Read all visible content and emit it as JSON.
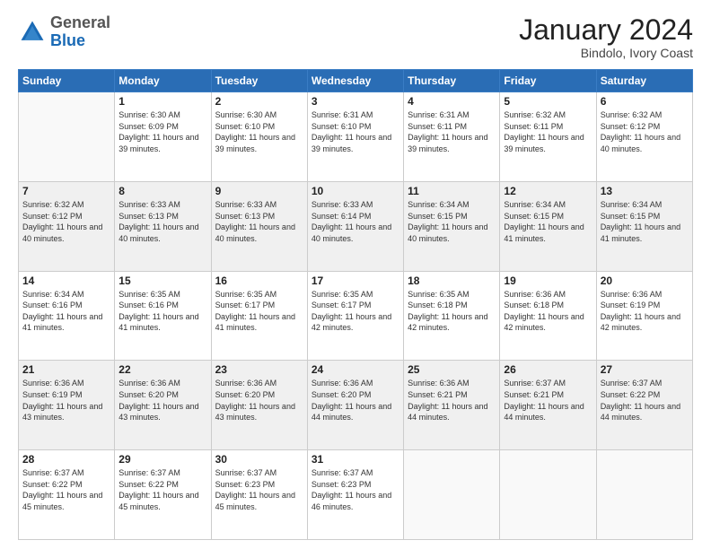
{
  "logo": {
    "general": "General",
    "blue": "Blue"
  },
  "header": {
    "month": "January 2024",
    "location": "Bindolo, Ivory Coast"
  },
  "weekdays": [
    "Sunday",
    "Monday",
    "Tuesday",
    "Wednesday",
    "Thursday",
    "Friday",
    "Saturday"
  ],
  "weeks": [
    [
      {
        "day": "",
        "sunrise": "",
        "sunset": "",
        "daylight": ""
      },
      {
        "day": "1",
        "sunrise": "Sunrise: 6:30 AM",
        "sunset": "Sunset: 6:09 PM",
        "daylight": "Daylight: 11 hours and 39 minutes."
      },
      {
        "day": "2",
        "sunrise": "Sunrise: 6:30 AM",
        "sunset": "Sunset: 6:10 PM",
        "daylight": "Daylight: 11 hours and 39 minutes."
      },
      {
        "day": "3",
        "sunrise": "Sunrise: 6:31 AM",
        "sunset": "Sunset: 6:10 PM",
        "daylight": "Daylight: 11 hours and 39 minutes."
      },
      {
        "day": "4",
        "sunrise": "Sunrise: 6:31 AM",
        "sunset": "Sunset: 6:11 PM",
        "daylight": "Daylight: 11 hours and 39 minutes."
      },
      {
        "day": "5",
        "sunrise": "Sunrise: 6:32 AM",
        "sunset": "Sunset: 6:11 PM",
        "daylight": "Daylight: 11 hours and 39 minutes."
      },
      {
        "day": "6",
        "sunrise": "Sunrise: 6:32 AM",
        "sunset": "Sunset: 6:12 PM",
        "daylight": "Daylight: 11 hours and 40 minutes."
      }
    ],
    [
      {
        "day": "7",
        "sunrise": "Sunrise: 6:32 AM",
        "sunset": "Sunset: 6:12 PM",
        "daylight": "Daylight: 11 hours and 40 minutes."
      },
      {
        "day": "8",
        "sunrise": "Sunrise: 6:33 AM",
        "sunset": "Sunset: 6:13 PM",
        "daylight": "Daylight: 11 hours and 40 minutes."
      },
      {
        "day": "9",
        "sunrise": "Sunrise: 6:33 AM",
        "sunset": "Sunset: 6:13 PM",
        "daylight": "Daylight: 11 hours and 40 minutes."
      },
      {
        "day": "10",
        "sunrise": "Sunrise: 6:33 AM",
        "sunset": "Sunset: 6:14 PM",
        "daylight": "Daylight: 11 hours and 40 minutes."
      },
      {
        "day": "11",
        "sunrise": "Sunrise: 6:34 AM",
        "sunset": "Sunset: 6:15 PM",
        "daylight": "Daylight: 11 hours and 40 minutes."
      },
      {
        "day": "12",
        "sunrise": "Sunrise: 6:34 AM",
        "sunset": "Sunset: 6:15 PM",
        "daylight": "Daylight: 11 hours and 41 minutes."
      },
      {
        "day": "13",
        "sunrise": "Sunrise: 6:34 AM",
        "sunset": "Sunset: 6:15 PM",
        "daylight": "Daylight: 11 hours and 41 minutes."
      }
    ],
    [
      {
        "day": "14",
        "sunrise": "Sunrise: 6:34 AM",
        "sunset": "Sunset: 6:16 PM",
        "daylight": "Daylight: 11 hours and 41 minutes."
      },
      {
        "day": "15",
        "sunrise": "Sunrise: 6:35 AM",
        "sunset": "Sunset: 6:16 PM",
        "daylight": "Daylight: 11 hours and 41 minutes."
      },
      {
        "day": "16",
        "sunrise": "Sunrise: 6:35 AM",
        "sunset": "Sunset: 6:17 PM",
        "daylight": "Daylight: 11 hours and 41 minutes."
      },
      {
        "day": "17",
        "sunrise": "Sunrise: 6:35 AM",
        "sunset": "Sunset: 6:17 PM",
        "daylight": "Daylight: 11 hours and 42 minutes."
      },
      {
        "day": "18",
        "sunrise": "Sunrise: 6:35 AM",
        "sunset": "Sunset: 6:18 PM",
        "daylight": "Daylight: 11 hours and 42 minutes."
      },
      {
        "day": "19",
        "sunrise": "Sunrise: 6:36 AM",
        "sunset": "Sunset: 6:18 PM",
        "daylight": "Daylight: 11 hours and 42 minutes."
      },
      {
        "day": "20",
        "sunrise": "Sunrise: 6:36 AM",
        "sunset": "Sunset: 6:19 PM",
        "daylight": "Daylight: 11 hours and 42 minutes."
      }
    ],
    [
      {
        "day": "21",
        "sunrise": "Sunrise: 6:36 AM",
        "sunset": "Sunset: 6:19 PM",
        "daylight": "Daylight: 11 hours and 43 minutes."
      },
      {
        "day": "22",
        "sunrise": "Sunrise: 6:36 AM",
        "sunset": "Sunset: 6:20 PM",
        "daylight": "Daylight: 11 hours and 43 minutes."
      },
      {
        "day": "23",
        "sunrise": "Sunrise: 6:36 AM",
        "sunset": "Sunset: 6:20 PM",
        "daylight": "Daylight: 11 hours and 43 minutes."
      },
      {
        "day": "24",
        "sunrise": "Sunrise: 6:36 AM",
        "sunset": "Sunset: 6:20 PM",
        "daylight": "Daylight: 11 hours and 44 minutes."
      },
      {
        "day": "25",
        "sunrise": "Sunrise: 6:36 AM",
        "sunset": "Sunset: 6:21 PM",
        "daylight": "Daylight: 11 hours and 44 minutes."
      },
      {
        "day": "26",
        "sunrise": "Sunrise: 6:37 AM",
        "sunset": "Sunset: 6:21 PM",
        "daylight": "Daylight: 11 hours and 44 minutes."
      },
      {
        "day": "27",
        "sunrise": "Sunrise: 6:37 AM",
        "sunset": "Sunset: 6:22 PM",
        "daylight": "Daylight: 11 hours and 44 minutes."
      }
    ],
    [
      {
        "day": "28",
        "sunrise": "Sunrise: 6:37 AM",
        "sunset": "Sunset: 6:22 PM",
        "daylight": "Daylight: 11 hours and 45 minutes."
      },
      {
        "day": "29",
        "sunrise": "Sunrise: 6:37 AM",
        "sunset": "Sunset: 6:22 PM",
        "daylight": "Daylight: 11 hours and 45 minutes."
      },
      {
        "day": "30",
        "sunrise": "Sunrise: 6:37 AM",
        "sunset": "Sunset: 6:23 PM",
        "daylight": "Daylight: 11 hours and 45 minutes."
      },
      {
        "day": "31",
        "sunrise": "Sunrise: 6:37 AM",
        "sunset": "Sunset: 6:23 PM",
        "daylight": "Daylight: 11 hours and 46 minutes."
      },
      {
        "day": "",
        "sunrise": "",
        "sunset": "",
        "daylight": ""
      },
      {
        "day": "",
        "sunrise": "",
        "sunset": "",
        "daylight": ""
      },
      {
        "day": "",
        "sunrise": "",
        "sunset": "",
        "daylight": ""
      }
    ]
  ]
}
